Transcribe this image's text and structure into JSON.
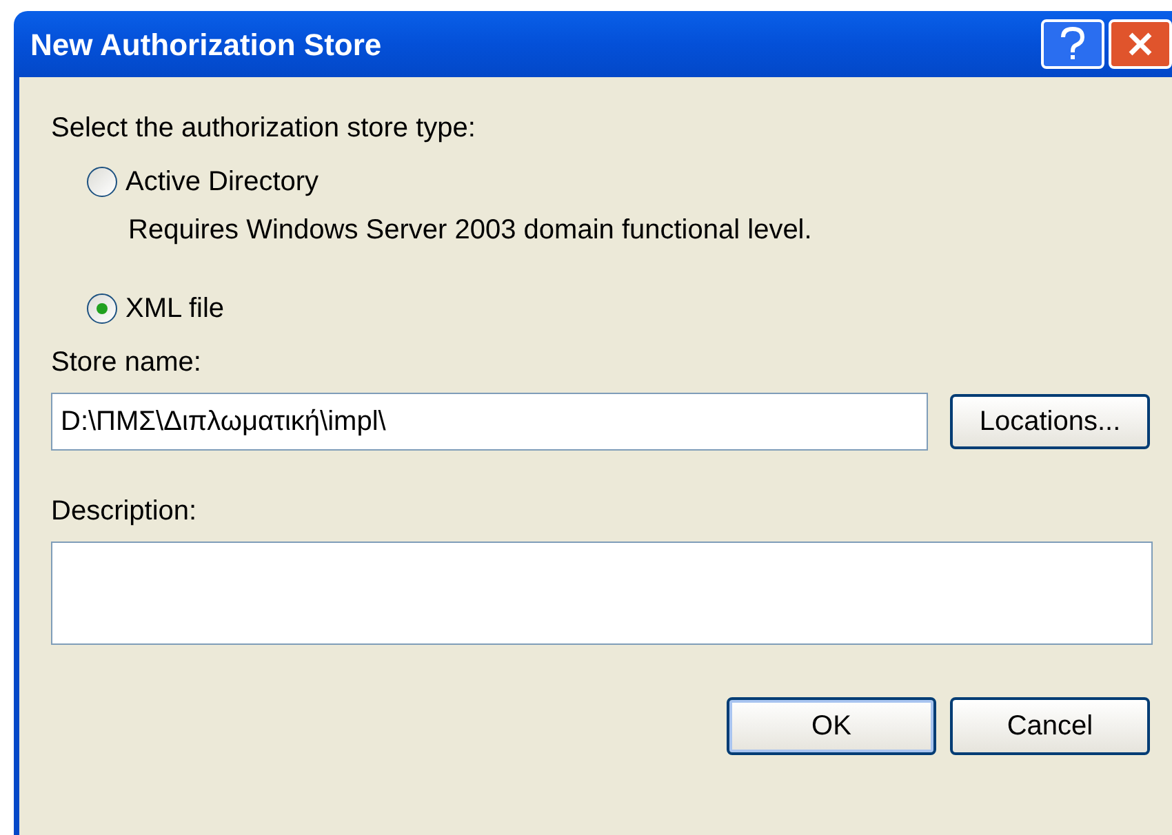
{
  "window": {
    "title": "New Authorization Store"
  },
  "store_type": {
    "label": "Select the authorization store type:",
    "options": [
      {
        "label": "Active Directory",
        "note": "Requires Windows Server 2003 domain functional level.",
        "selected": false
      },
      {
        "label": "XML file",
        "selected": true
      }
    ]
  },
  "store_name": {
    "label": "Store name:",
    "value": "D:\\ΠΜΣ\\Διπλωματική\\impl\\",
    "button": "Locations..."
  },
  "description": {
    "label": "Description:"
  },
  "buttons": [
    {
      "label": "OK",
      "default": true
    },
    {
      "label": "Cancel",
      "default": false
    }
  ]
}
